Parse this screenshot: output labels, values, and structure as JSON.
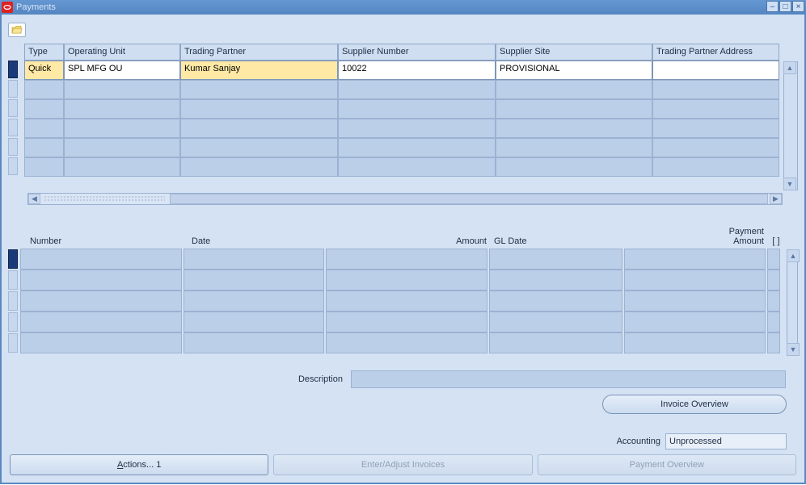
{
  "window": {
    "title": "Payments"
  },
  "top_grid": {
    "headers": {
      "type": "Type",
      "operating_unit": "Operating Unit",
      "trading_partner": "Trading Partner",
      "supplier_number": "Supplier Number",
      "supplier_site": "Supplier Site",
      "trading_partner_address": "Trading Partner Address"
    },
    "rows": [
      {
        "type": "Quick",
        "operating_unit": "SPL MFG OU",
        "trading_partner": "Kumar Sanjay",
        "supplier_number": "10022",
        "supplier_site": "PROVISIONAL",
        "trading_partner_address": ""
      }
    ]
  },
  "bottom_grid": {
    "headers": {
      "number": "Number",
      "date": "Date",
      "amount": "Amount",
      "gl_date": "GL Date",
      "payment": "Payment",
      "payment_amount": "Amount",
      "flag": "[  ]"
    }
  },
  "description": {
    "label": "Description",
    "value": ""
  },
  "buttons": {
    "invoice_overview": "Invoice Overview",
    "actions": "Actions... 1",
    "enter_adjust": "Enter/Adjust Invoices",
    "payment_overview": "Payment Overview"
  },
  "accounting": {
    "label": "Accounting",
    "value": "Unprocessed"
  }
}
